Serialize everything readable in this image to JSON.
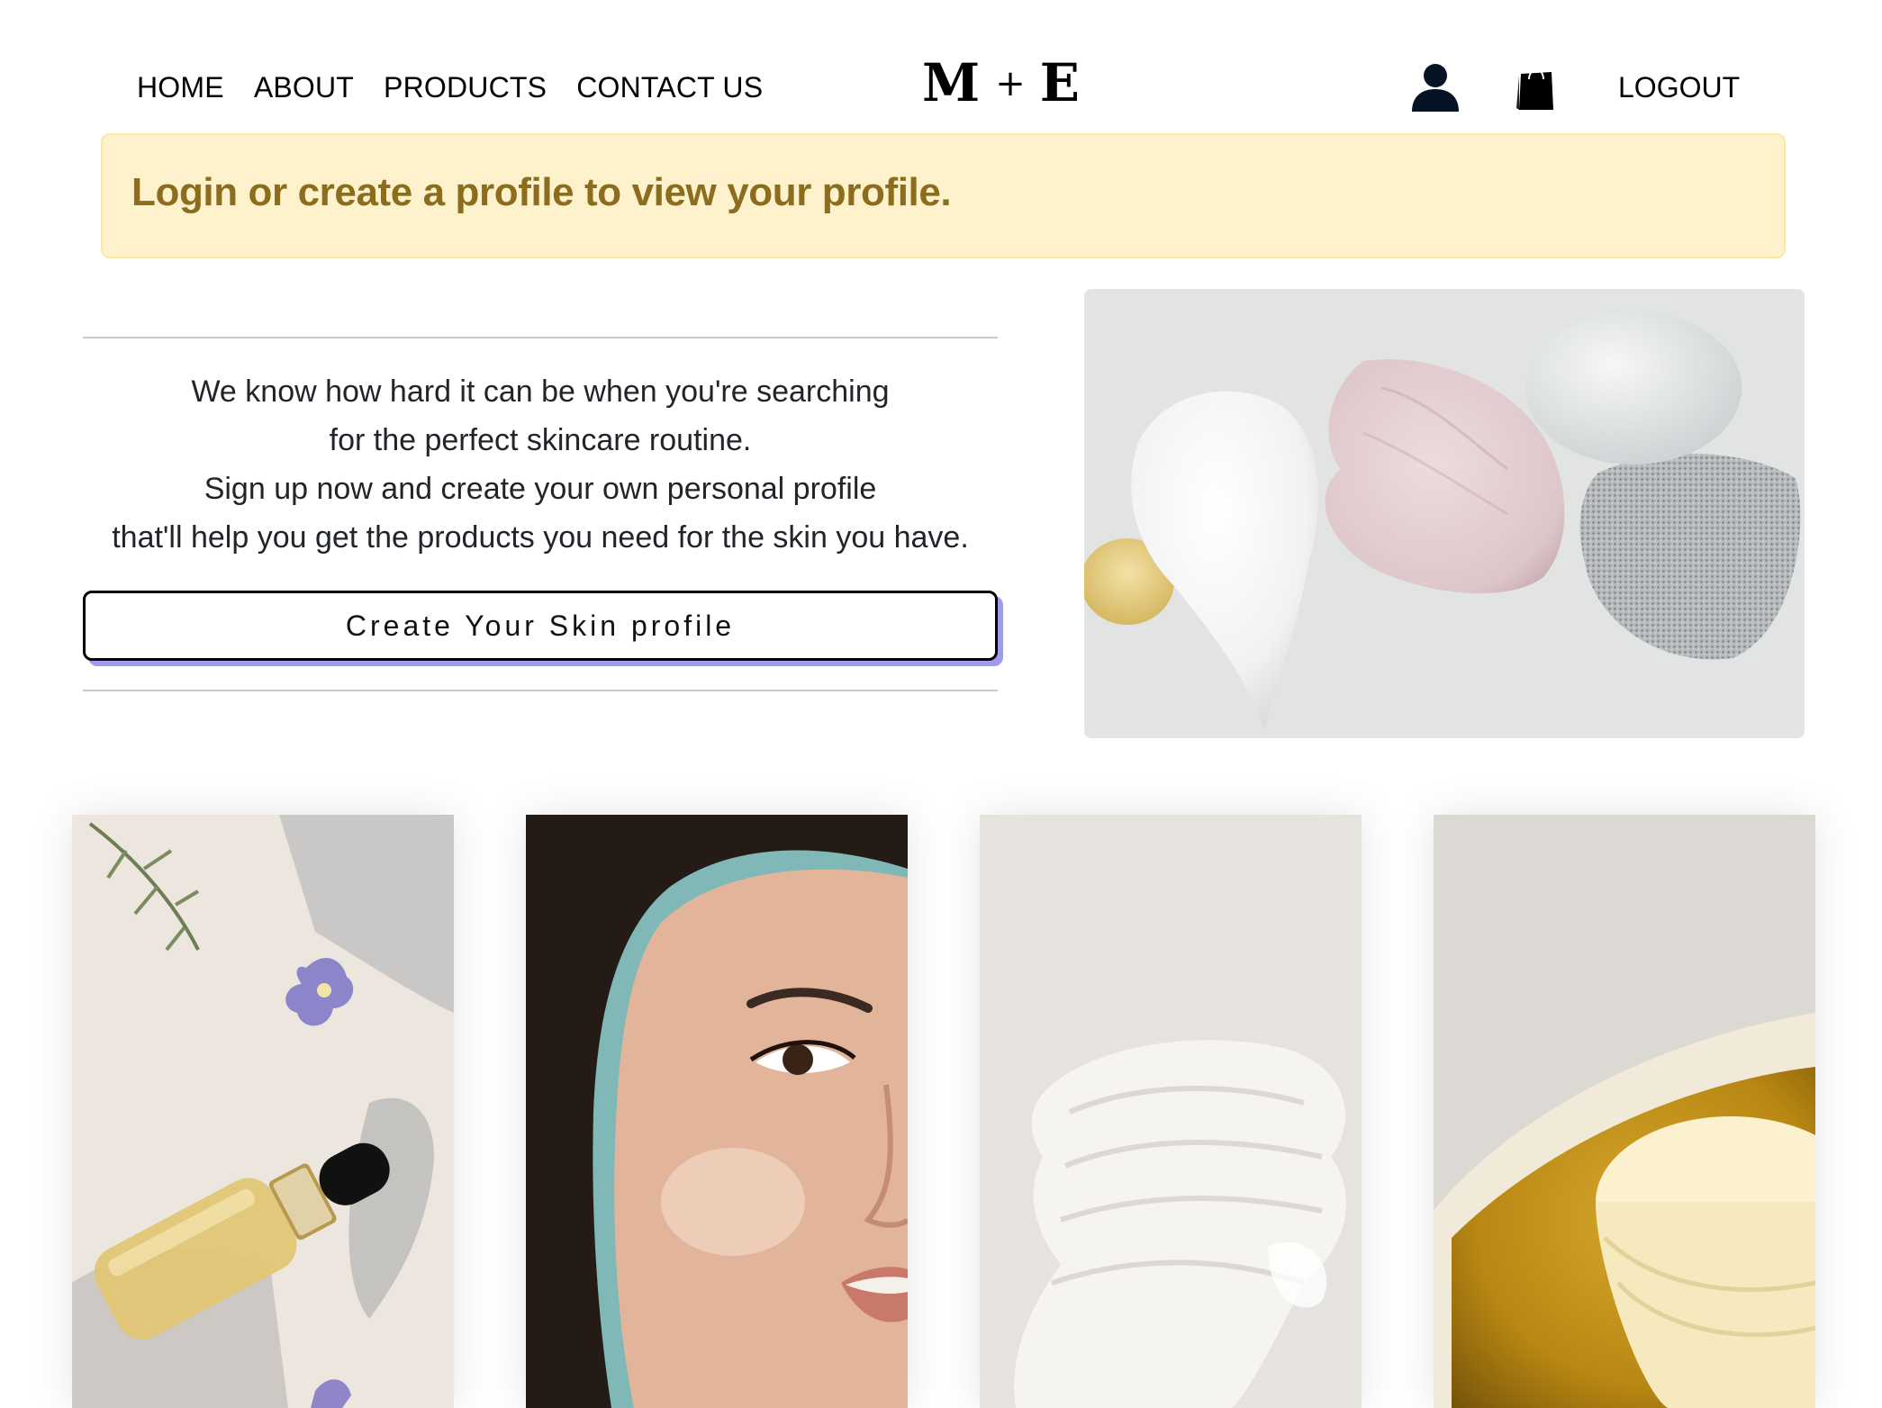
{
  "nav": {
    "links": [
      "HOME",
      "ABOUT",
      "PRODUCTS",
      "CONTACT US"
    ],
    "logo": {
      "left": "M",
      "plus": "+",
      "right": "E"
    },
    "icons": [
      "user-icon",
      "shopping-bag-icon"
    ],
    "logout_label": "LOGOUT"
  },
  "alert": {
    "message": "Login or create a profile to view your profile."
  },
  "intro": {
    "lines": [
      "We know how hard it can be when you're searching",
      "for the perfect skincare routine.",
      "Sign up now and create your own personal profile",
      "that'll help you get the products you need for the skin you have."
    ],
    "cta_label": "Create Your Skin profile"
  },
  "colors": {
    "alert_bg": "#fdf2cc",
    "alert_border": "#fbe8a3",
    "alert_text": "#8b6d1d",
    "cta_shadow": "#9f9cf0",
    "divider": "#c9c9c9"
  },
  "images": {
    "hero": "cream-texture-swatches-image",
    "cards": [
      "serum-dropper-and-flowers-image",
      "woman-face-glowing-skin-image",
      "white-cream-swatch-image",
      "yellow-balm-jar-image"
    ]
  }
}
